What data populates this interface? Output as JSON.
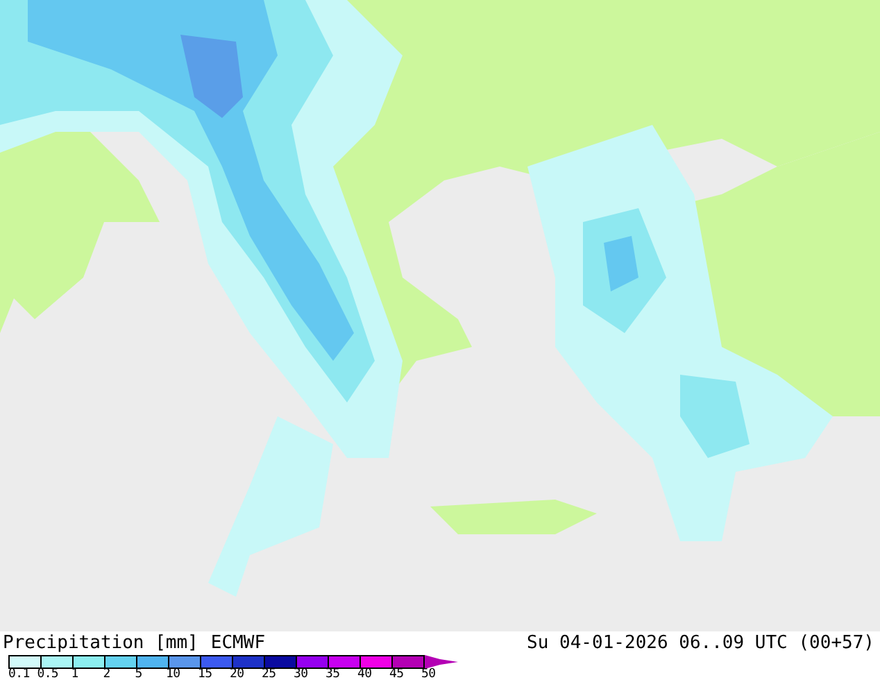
{
  "legend": {
    "title": "Precipitation [mm]",
    "model": "ECMWF",
    "segments": [
      {
        "color": "#d2fafa"
      },
      {
        "color": "#aaf5f5"
      },
      {
        "color": "#8ceef0"
      },
      {
        "color": "#64d2f0"
      },
      {
        "color": "#50b4f0"
      },
      {
        "color": "#5a96eb"
      },
      {
        "color": "#3c5af0"
      },
      {
        "color": "#1e32c8"
      },
      {
        "color": "#0a0aa0"
      },
      {
        "color": "#9600f0"
      },
      {
        "color": "#c800f0"
      },
      {
        "color": "#f000e6"
      },
      {
        "color": "#b400b4"
      }
    ],
    "ticks": [
      "0.1",
      "0.5",
      "1",
      "2",
      "5",
      "10",
      "15",
      "20",
      "25",
      "30",
      "35",
      "40",
      "45",
      "50"
    ]
  },
  "valid_time": "Su 04-01-2026 06..09 UTC (00+57)"
}
